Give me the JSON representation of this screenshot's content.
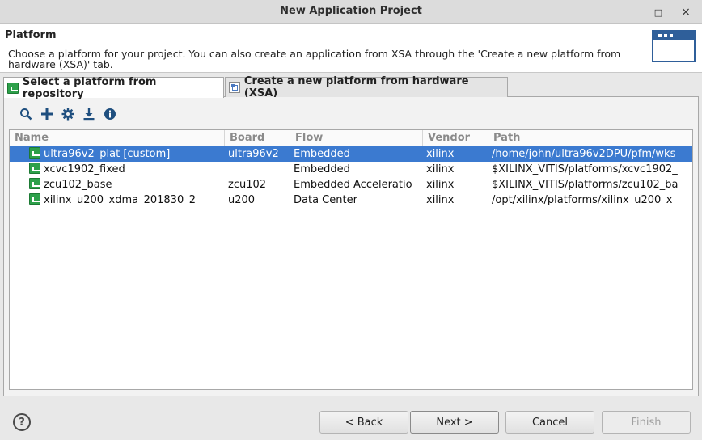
{
  "window": {
    "title": "New Application Project",
    "minimize_glyph": "□",
    "close_glyph": "×"
  },
  "header": {
    "title": "Platform",
    "description": "Choose a platform for your project. You can also create an application from XSA through the 'Create a new platform from hardware (XSA)' tab."
  },
  "tabs": [
    {
      "label": "Select a platform from repository",
      "active": true,
      "icon": "platform-icon"
    },
    {
      "label": "Create a new platform from hardware (XSA)",
      "active": false,
      "icon": "hardware-icon"
    }
  ],
  "toolbar": {
    "icons": [
      "search-icon",
      "add-icon",
      "gear-icon",
      "download-icon",
      "info-icon"
    ]
  },
  "table": {
    "columns": [
      "Name",
      "Board",
      "Flow",
      "Vendor",
      "Path"
    ],
    "rows": [
      {
        "name": "ultra96v2_plat [custom]",
        "board": "ultra96v2",
        "flow": "Embedded",
        "vendor": "xilinx",
        "path": "/home/john/ultra96v2DPU/pfm/wks",
        "selected": true
      },
      {
        "name": "xcvc1902_fixed",
        "board": "",
        "flow": "Embedded",
        "vendor": "xilinx",
        "path": "$XILINX_VITIS/platforms/xcvc1902_",
        "selected": false
      },
      {
        "name": "zcu102_base",
        "board": "zcu102",
        "flow": "Embedded Acceleratio",
        "vendor": "xilinx",
        "path": "$XILINX_VITIS/platforms/zcu102_ba",
        "selected": false
      },
      {
        "name": "xilinx_u200_xdma_201830_2",
        "board": "u200",
        "flow": "Data Center",
        "vendor": "xilinx",
        "path": "/opt/xilinx/platforms/xilinx_u200_x",
        "selected": false
      }
    ]
  },
  "buttons": {
    "help": "?",
    "back": "< Back",
    "next": "Next >",
    "cancel": "Cancel",
    "finish": "Finish"
  },
  "colors": {
    "selection": "#3b7ad0",
    "platform_icon": "#2da04a",
    "toolbar_icon": "#1f4f7f"
  }
}
